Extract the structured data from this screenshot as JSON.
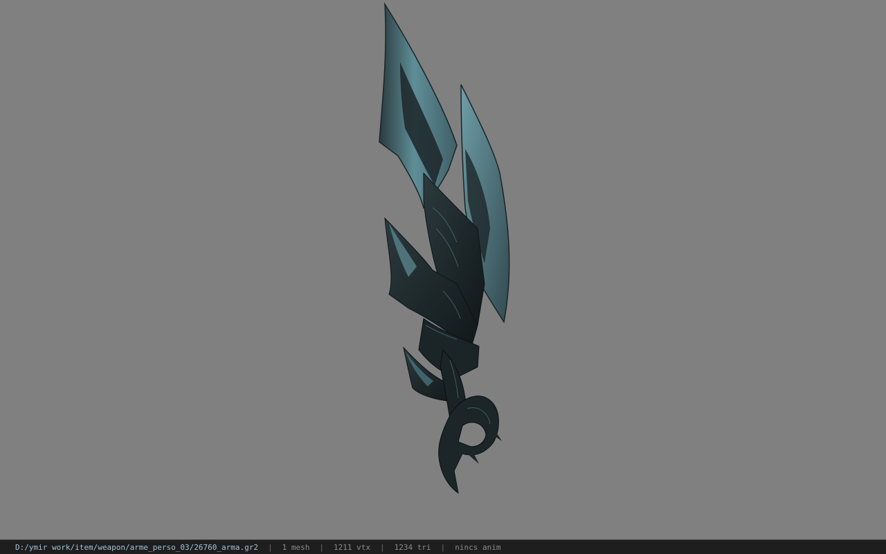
{
  "viewer": {
    "background_color": "#808080",
    "model_color_light": "#5f8e98",
    "model_color_dark": "#1a2326",
    "model_subject": "weapon-model"
  },
  "statusbar": {
    "file_path": "D:/ymir work/item/weapon/arme_perso_03/26760_arma.gr2",
    "separator": "|",
    "mesh_count": "1 mesh",
    "vertex_count": "1211 vtx",
    "triangle_count": "1234 tri",
    "anim_status": "nincs anim"
  }
}
